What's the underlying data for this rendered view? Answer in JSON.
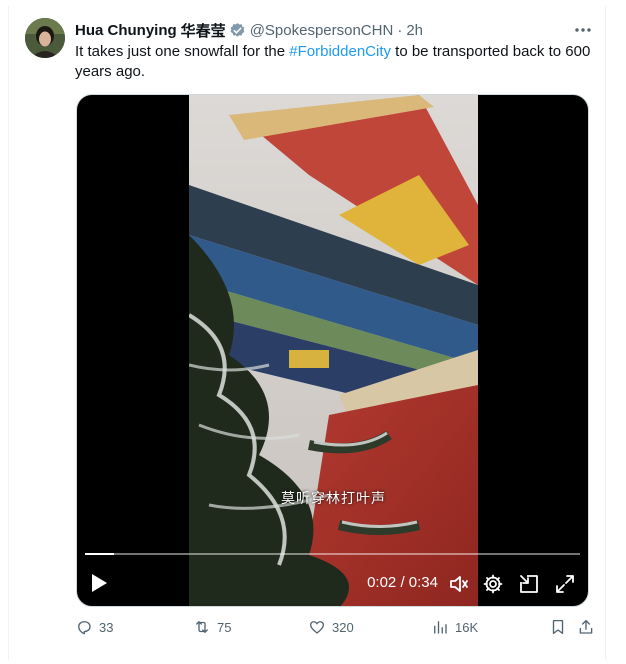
{
  "author": {
    "name": "Hua Chunying",
    "name_native": "华春莹",
    "handle": "@SpokespersonCHN",
    "separator": "·",
    "time": "2h",
    "verified_color": "#829aab"
  },
  "tweet": {
    "text_before": "It takes just one snowfall for the ",
    "hashtag": "#ForbiddenCity",
    "text_after": " to be transported back to 600 years ago.",
    "hashtag_color": "#1d9bf0"
  },
  "video": {
    "subtitle": "莫听穿林打叶声",
    "current_time": "0:02",
    "time_separator": " / ",
    "duration": "0:34",
    "progress_fraction": 0.059,
    "icons": [
      "play-icon",
      "volume-icon",
      "settings-icon",
      "picture-in-picture-icon",
      "fullscreen-icon"
    ]
  },
  "actions": {
    "replies": "33",
    "reposts": "75",
    "likes": "320",
    "views": "16K"
  }
}
